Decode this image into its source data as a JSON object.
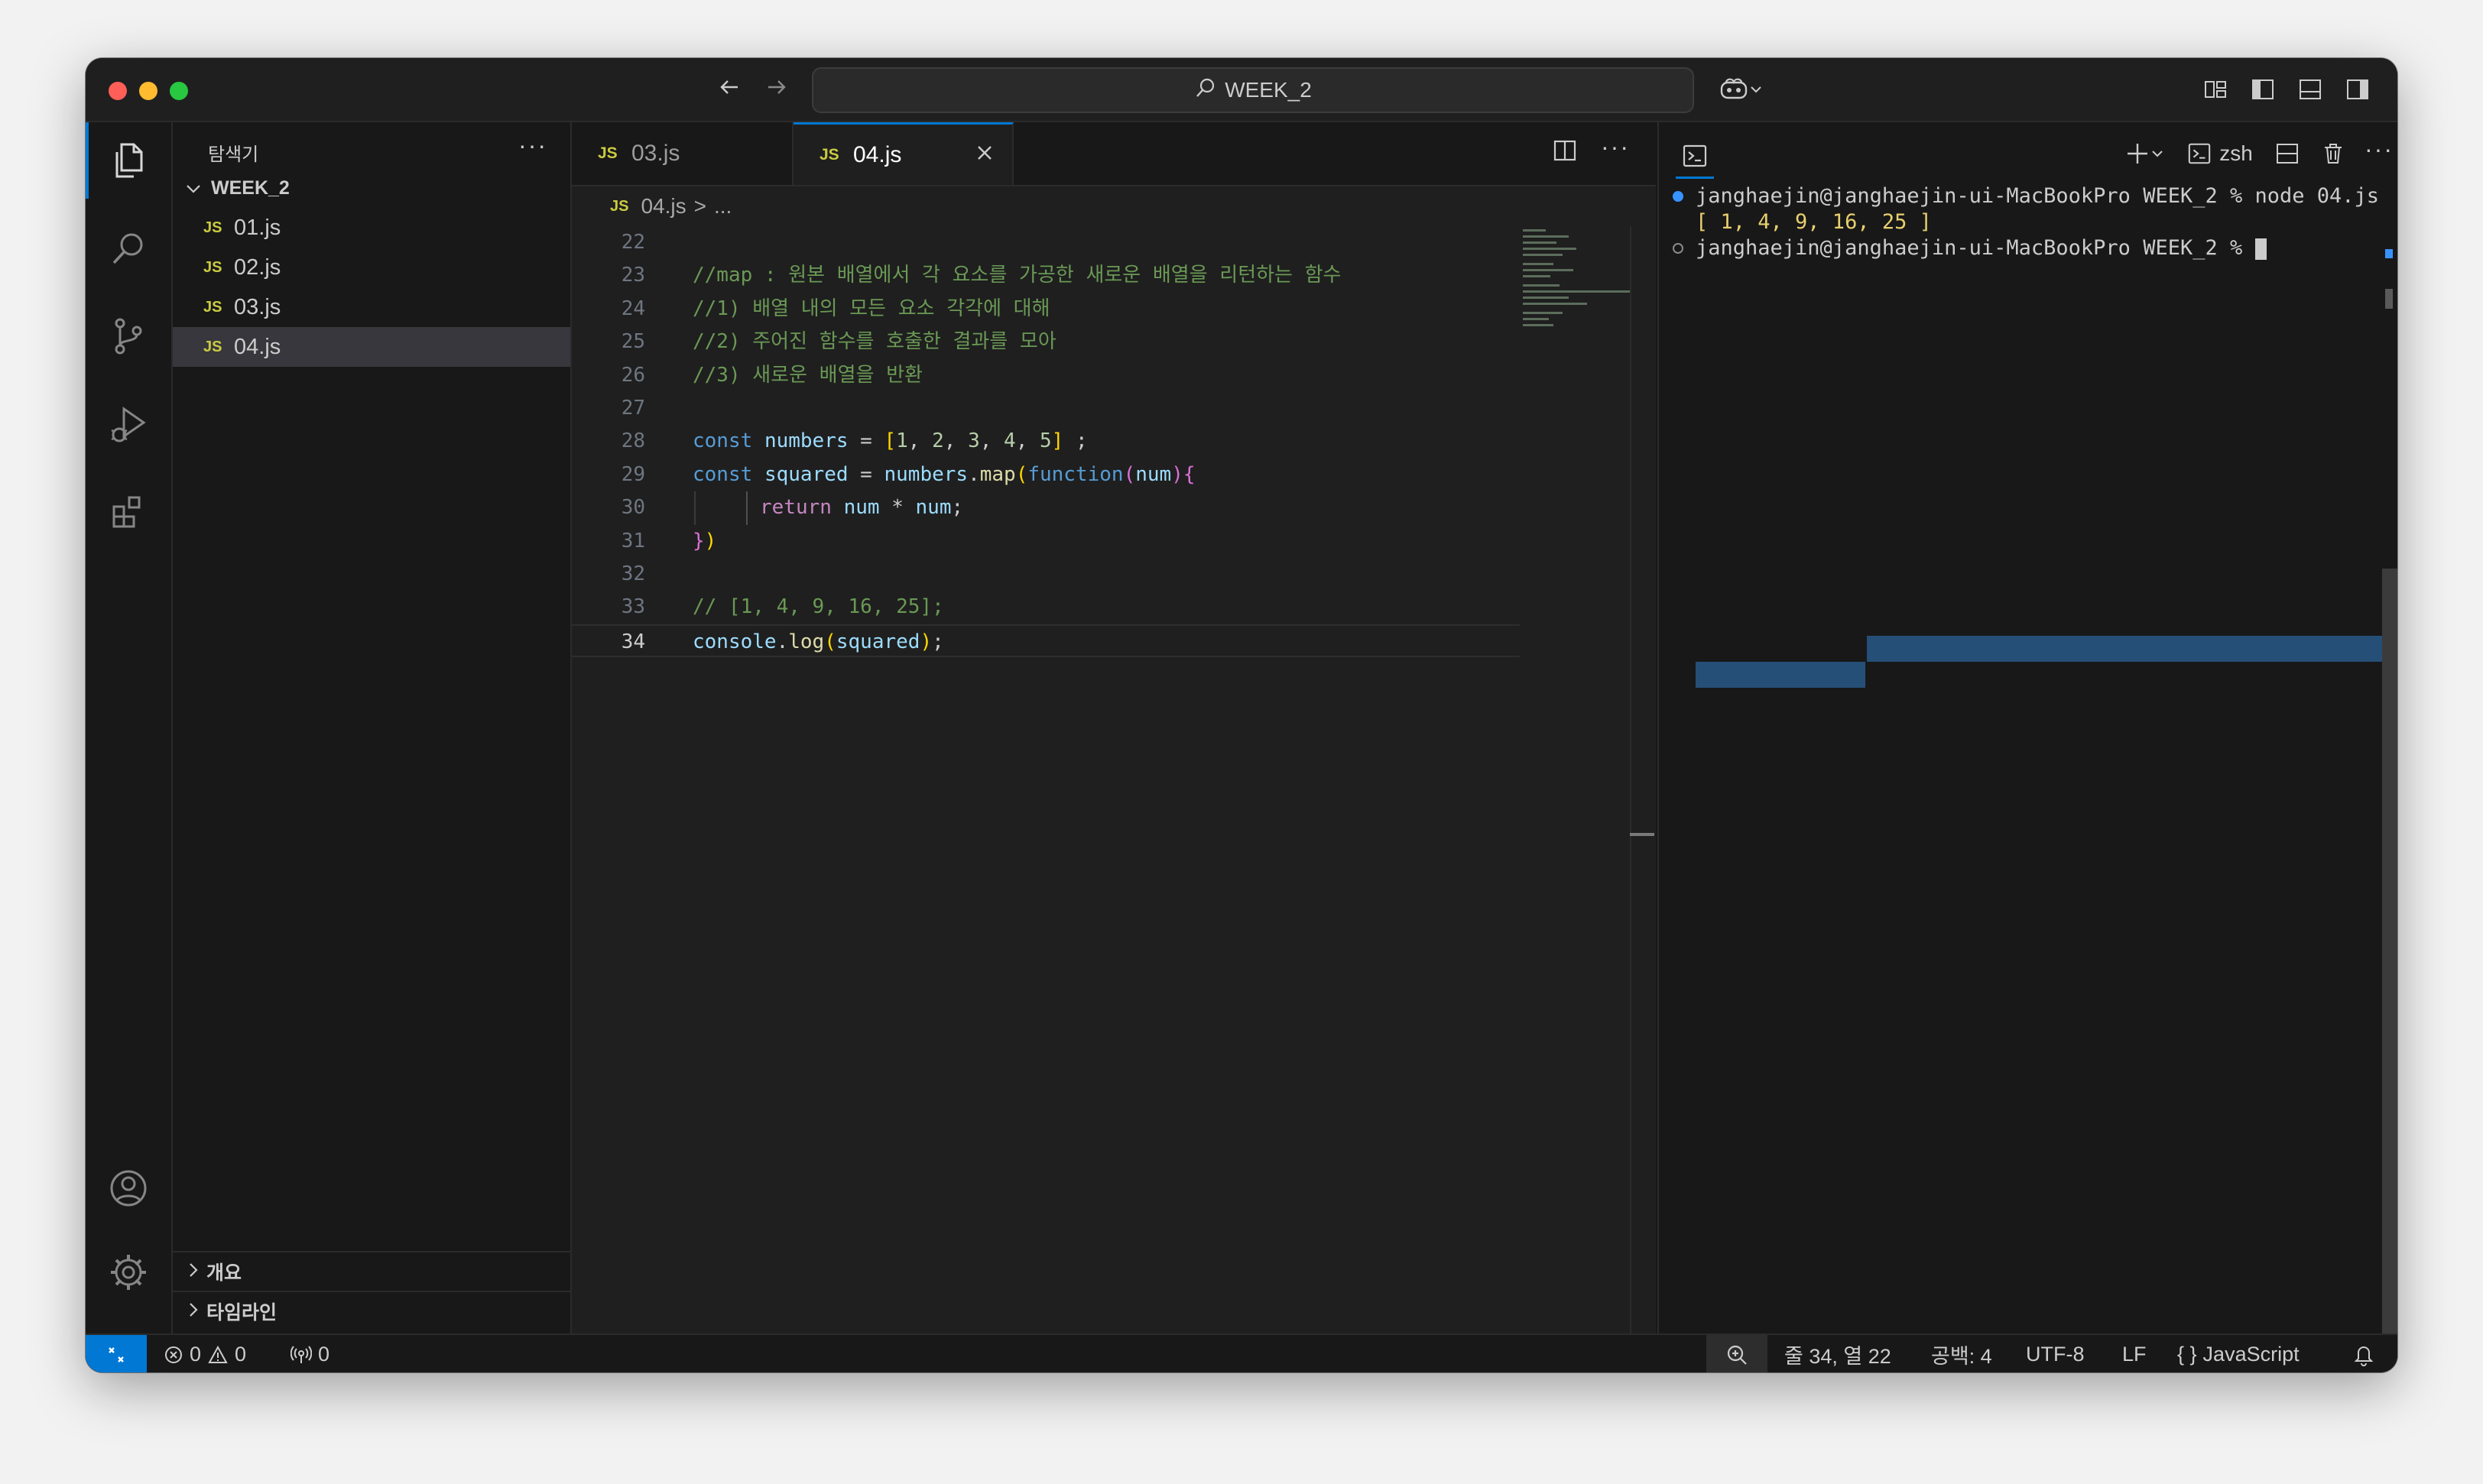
{
  "title_bar": {
    "search_text": "WEEK_2",
    "icons": [
      "arrow-left-icon",
      "arrow-right-icon",
      "search-icon",
      "copilot-icon",
      "chevron-down-icon",
      "customize-layout-icon",
      "toggle-primary-sidebar-icon",
      "toggle-panel-icon",
      "toggle-secondary-sidebar-icon"
    ]
  },
  "activity_bar": {
    "items": [
      "explorer",
      "search",
      "source-control",
      "run-and-debug",
      "extensions"
    ],
    "bottom": [
      "accounts",
      "manage"
    ]
  },
  "sidebar": {
    "title": "탐색기",
    "more": "···",
    "folder": "WEEK_2",
    "files": [
      "01.js",
      "02.js",
      "03.js",
      "04.js"
    ],
    "selected_file": "04.js",
    "file_badge": "JS",
    "sections": [
      "개요",
      "타임라인"
    ]
  },
  "editor": {
    "tabs": [
      {
        "label": "03.js",
        "active": false
      },
      {
        "label": "04.js",
        "active": true
      }
    ],
    "breadcrumb": {
      "file": "04.js",
      "sep": ">",
      "rest": "..."
    },
    "lines": [
      {
        "n": "22"
      },
      {
        "n": "23",
        "comment": "//map : 원본 배열에서 각 요소를 가공한 새로운 배열을 리턴하는 함수"
      },
      {
        "n": "24",
        "comment": "//1) 배열 내의 모든 요소 각각에 대해"
      },
      {
        "n": "25",
        "comment": "//2) 주어진 함수를 호출한 결과를 모아"
      },
      {
        "n": "26",
        "comment": "//3) 새로운 배열을 반환"
      },
      {
        "n": "27"
      },
      {
        "n": "28"
      },
      {
        "n": "29"
      },
      {
        "n": "30"
      },
      {
        "n": "31"
      },
      {
        "n": "32"
      },
      {
        "n": "33",
        "comment": "// [1, 4, 9, 16, 25];"
      },
      {
        "n": "34"
      }
    ],
    "code": {
      "kw_const": "const",
      "numbers": "numbers",
      "squared": "squared",
      "eq": " = ",
      "nums": [
        "1",
        "2",
        "3",
        "4",
        "5"
      ],
      "map": "map",
      "function": "function",
      "num": "num",
      "return": "return",
      "star": " * ",
      "console": "console",
      "log": "log"
    }
  },
  "terminal": {
    "shell": "zsh",
    "lines": [
      "janghaejin@janghaejin-ui-MacBookPro WEEK_2 % node 04.js",
      "[ 1, 4, 9, 16, 25 ]",
      "janghaejin@janghaejin-ui-MacBookPro WEEK_2 % "
    ]
  },
  "status_bar": {
    "errors": "0",
    "warnings": "0",
    "ports": "0",
    "cursor": "줄 34, 열 22",
    "spaces": "공백: 4",
    "encoding": "UTF-8",
    "eol": "LF",
    "language": "JavaScript",
    "language_icon": "{ }"
  }
}
